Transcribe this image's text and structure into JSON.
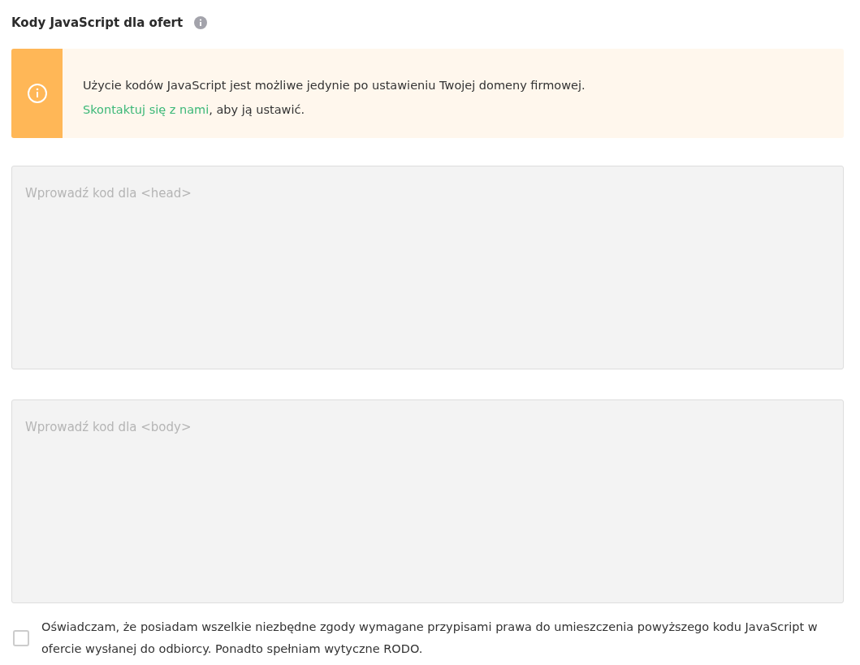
{
  "section": {
    "title": "Kody JavaScript dla ofert"
  },
  "notice": {
    "text": "Użycie kodów JavaScript jest możliwe jedynie po ustawieniu Twojej domeny firmowej.",
    "link": "Skontaktuj się z nami",
    "after_link": ", aby ją ustawić."
  },
  "code_fields": [
    {
      "placeholder": "Wprowadź kod dla <head>",
      "disabled": true
    },
    {
      "placeholder": "Wprowadź kod dla <body>",
      "disabled": true
    }
  ],
  "consent": {
    "label": "Oświadczam, że posiadam wszelkie niezbędne zgody wymagane przypisami prawa do umieszczenia powyższego kodu JavaScript w ofercie wysłanej do odbiorcy. Ponadto spełniam wytyczne RODO.",
    "checked": false
  }
}
